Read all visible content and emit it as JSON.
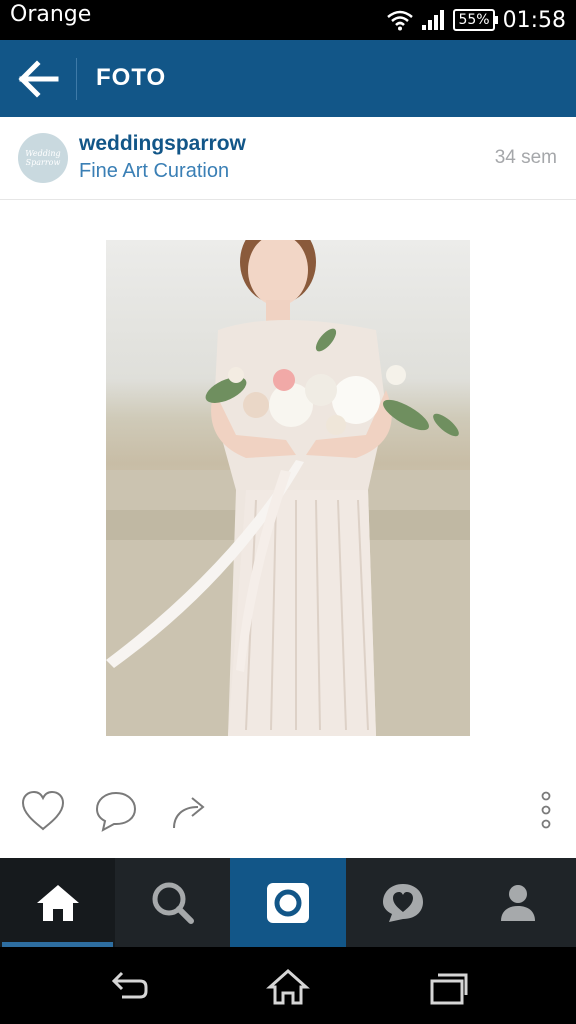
{
  "status_bar": {
    "carrier": "Orange",
    "battery": "55%",
    "time": "01:58"
  },
  "app_bar": {
    "title": "FOTO"
  },
  "post": {
    "username": "weddingsparrow",
    "location": "Fine Art Curation",
    "timestamp": "34 sem",
    "avatar_text": "Wedding Sparrow"
  },
  "icons": {
    "back": "arrow-left-icon",
    "like": "heart-icon",
    "comment": "comment-icon",
    "share": "share-icon",
    "more": "more-vertical-icon",
    "nav": [
      "home-icon",
      "search-icon",
      "camera-icon",
      "activity-heart-icon",
      "profile-icon"
    ],
    "system": [
      "back-icon",
      "home-icon",
      "recents-icon"
    ]
  },
  "colors": {
    "brand": "#125688",
    "nav_bg": "#1f2428",
    "status_bg": "#000000"
  }
}
